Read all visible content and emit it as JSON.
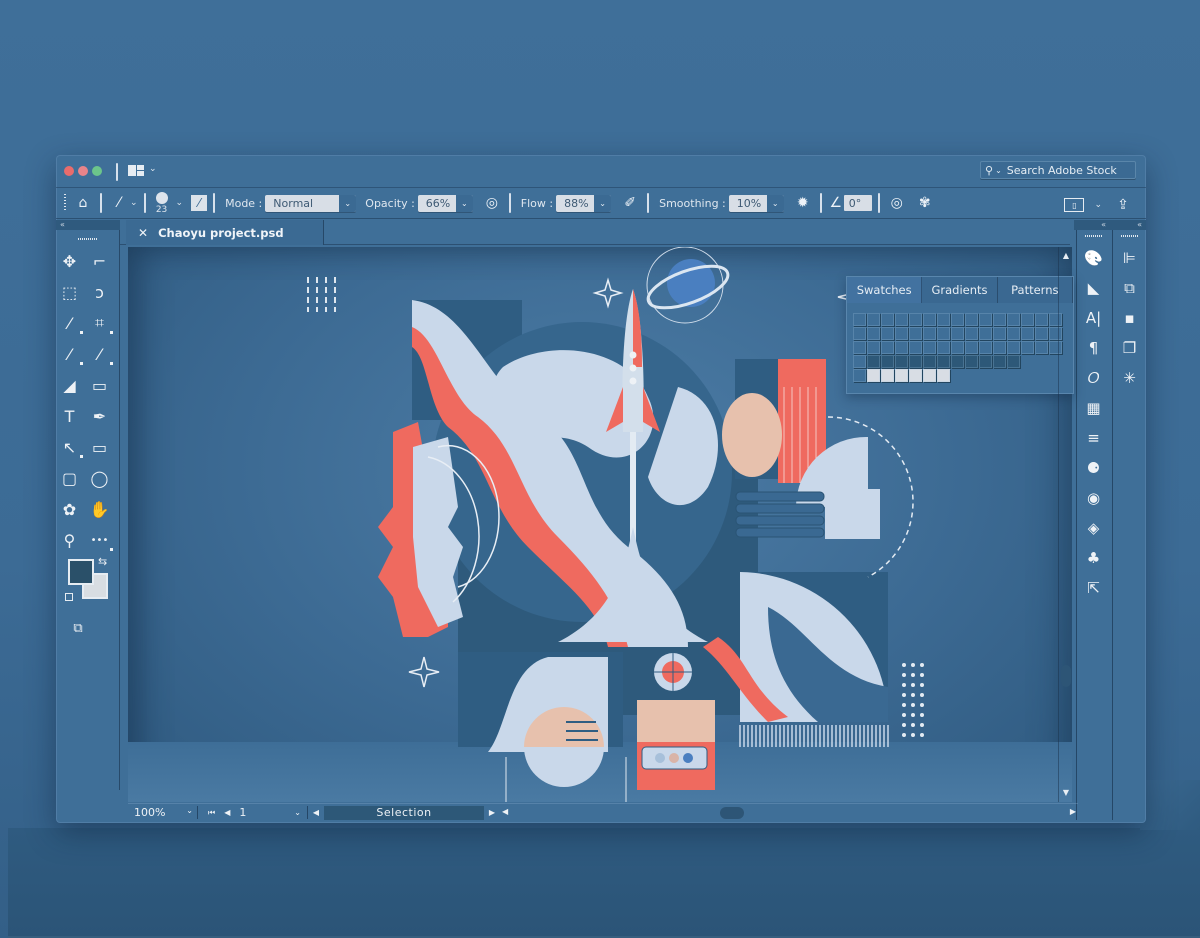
{
  "window": {
    "title_controls": [
      "close",
      "minimize",
      "maximize"
    ],
    "workspace_icon": "workspace-layout-icon",
    "search": {
      "placeholder": "Search Adobe Stock",
      "icon": "search-icon"
    }
  },
  "options_bar": {
    "home_icon": "home-icon",
    "brush_preset_icon": "brush-icon",
    "brush_size": "23",
    "mode_label": "Mode :",
    "mode_value": "Normal",
    "opacity_label": "Opacity :",
    "opacity_value": "66%",
    "flow_label": "Flow :",
    "flow_value": "88%",
    "smoothing_label": "Smoothing :",
    "smoothing_value": "10%",
    "angle_value": "0°",
    "share_icon": "share-icon",
    "screen_mode_icon": "screen-mode-icon"
  },
  "document": {
    "tab_title": "Chaoyu project.psd",
    "close_icon": "×"
  },
  "left_tools": [
    {
      "name": "move-tool",
      "glyph": "✥"
    },
    {
      "name": "artboard-tool",
      "glyph": "⌐"
    },
    {
      "name": "marquee-tool",
      "glyph": "⬚"
    },
    {
      "name": "lasso-tool",
      "glyph": "ↄ"
    },
    {
      "name": "magic-wand-tool",
      "glyph": "⁄"
    },
    {
      "name": "crop-tool",
      "glyph": "⌗"
    },
    {
      "name": "eyedropper-tool",
      "glyph": "⁄"
    },
    {
      "name": "brush-tool",
      "glyph": "⁄"
    },
    {
      "name": "eraser-tool",
      "glyph": "◢"
    },
    {
      "name": "gradient-tool",
      "glyph": "▭"
    },
    {
      "name": "type-tool",
      "glyph": "T"
    },
    {
      "name": "pen-tool",
      "glyph": "✒"
    },
    {
      "name": "path-selection-tool",
      "glyph": "↖"
    },
    {
      "name": "rectangle-tool",
      "glyph": "▭"
    },
    {
      "name": "rounded-rectangle-tool",
      "glyph": "▢"
    },
    {
      "name": "ellipse-tool",
      "glyph": "◯"
    },
    {
      "name": "custom-shape-tool",
      "glyph": "✿"
    },
    {
      "name": "hand-tool",
      "glyph": "✋"
    },
    {
      "name": "zoom-tool",
      "glyph": "⚲"
    },
    {
      "name": "more-tools",
      "glyph": "•••"
    }
  ],
  "colors": {
    "foreground": "#2a5069",
    "background": "#d8dde2"
  },
  "swatches_panel": {
    "tabs": [
      "Swatches",
      "Gradients",
      "Patterns"
    ],
    "active_tab": "Swatches"
  },
  "right_panel_col1": [
    "color-palette-icon",
    "shape-properties-icon",
    "character-icon",
    "paragraph-icon",
    "glyphs-icon",
    "grid-icon",
    "lines-icon",
    "channels-icon",
    "circle-icon",
    "layers-icon",
    "club-icon",
    "export-icon"
  ],
  "right_panel_col2": [
    "align-icon",
    "arrange-icon",
    "layer-comps-icon",
    "copy-icon",
    "transform-icon"
  ],
  "status_bar": {
    "zoom": "100%",
    "page": "1",
    "selection_label": "Selection"
  },
  "palette": {
    "ui_blue": "#3f6f98",
    "coral": "#ef6a5f",
    "pale_blue": "#c9d8ea",
    "peach": "#e7c1ad",
    "deep_blue": "#2e5a7c"
  }
}
